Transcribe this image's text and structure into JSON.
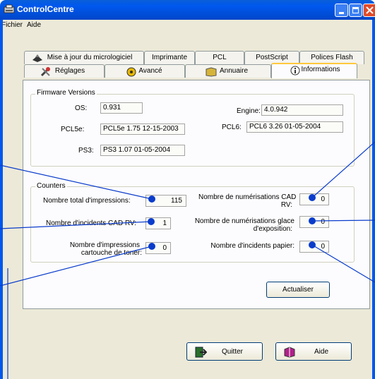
{
  "window": {
    "title": "ControlCentre"
  },
  "menu": {
    "items": [
      "Fichier",
      "Aide"
    ]
  },
  "tabs": {
    "row1": [
      "Mise à jour du micrologiciel",
      "Imprimante",
      "PCL",
      "PostScript",
      "Polices Flash"
    ],
    "row2": [
      "Réglages",
      "Avancé",
      "Annuaire",
      "Informations"
    ],
    "active": "Informations"
  },
  "firmware": {
    "title": "Firmware Versions",
    "os_label": "OS:",
    "os_value": "0.931",
    "engine_label": "Engine:",
    "engine_value": "4.0.942",
    "pcl5e_label": "PCL5e:",
    "pcl5e_value": "PCL5e 1.75 12-15-2003",
    "pcl6_label": "PCL6:",
    "pcl6_value": "PCL6 3.26 01-05-2004",
    "ps3_label": "PS3:",
    "ps3_value": "PS3 1.07 01-05-2004"
  },
  "counters": {
    "title": "Counters",
    "total_impressions_label": "Nombre total d'impressions:",
    "total_impressions_value": "115",
    "cad_rv_incidents_label": "Nombre d'incidents CAD RV:",
    "cad_rv_incidents_value": "1",
    "toner_impressions_label_1": "Nombre d'impressions",
    "toner_impressions_label_2": "cartouche de toner:",
    "toner_impressions_value": "0",
    "cad_scans_label_1": "Nombre de numérisations CAD",
    "cad_scans_label_2": "RV:",
    "cad_scans_value": "0",
    "glass_scans_label_1": "Nombre de numérisations glace",
    "glass_scans_label_2": "d'exposition:",
    "glass_scans_value": "0",
    "paper_incidents_label": "Nombre d'incidents papier:",
    "paper_incidents_value": "0"
  },
  "buttons": {
    "refresh": "Actualiser",
    "quit": "Quitter",
    "help": "Aide"
  },
  "colors": {
    "titlebar": "#0058ee",
    "dialog_bg": "#ece9d8",
    "callout": "#0a3ccc"
  }
}
